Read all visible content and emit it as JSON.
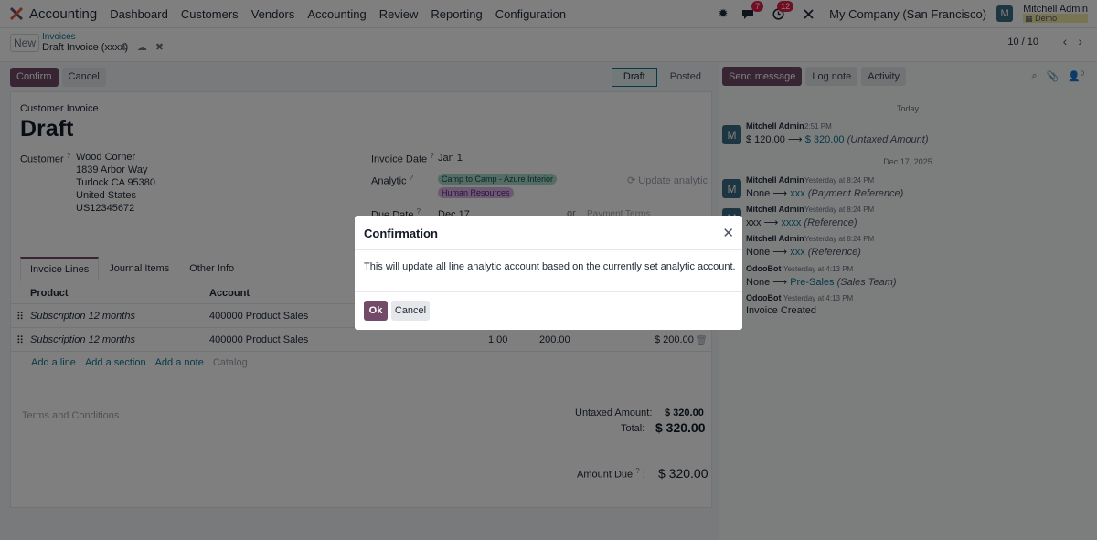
{
  "topbar": {
    "app_name": "Accounting",
    "menu": [
      "Dashboard",
      "Customers",
      "Vendors",
      "Accounting",
      "Review",
      "Reporting",
      "Configuration"
    ],
    "chat_badge": "7",
    "activity_badge": "12",
    "company": "My Company (San Francisco)",
    "user_initial": "M",
    "user_name": "Mitchell Admin",
    "user_db": "Demo"
  },
  "control": {
    "new_label": "New",
    "breadcrumb": "Invoices",
    "record_title": "Draft Invoice (xxxx)",
    "pager": "10 / 10"
  },
  "status": {
    "confirm_label": "Confirm",
    "cancel_label": "Cancel",
    "stages": [
      "Draft",
      "Posted"
    ]
  },
  "form": {
    "doc_type": "Customer Invoice",
    "state": "Draft",
    "customer_label": "Customer",
    "customer_lines": [
      "Wood Corner",
      "1839 Arbor Way",
      "Turlock CA 95380",
      "United States",
      "US12345672"
    ],
    "invoice_date_label": "Invoice Date",
    "invoice_date": "Jan 1",
    "analytic_label": "Analytic",
    "analytic_tags": [
      "Camp to Camp - Azure Interior",
      "Human Resources"
    ],
    "update_analytic": "Update analytic",
    "due_date_label": "Due Date",
    "due_date": "Dec 17",
    "or_label": "or",
    "payment_terms_placeholder": "Payment Terms",
    "help_mark": "?"
  },
  "tabs": [
    "Invoice Lines",
    "Journal Items",
    "Other Info"
  ],
  "lines": {
    "headers": [
      "Product",
      "Account"
    ],
    "rows": [
      {
        "product": "Subscription 12 months",
        "account": "400000 Product Sales",
        "qty": "",
        "price": "",
        "subtotal": ""
      },
      {
        "product": "Subscription 12 months",
        "account": "400000 Product Sales",
        "qty": "1.00",
        "price": "200.00",
        "subtotal": "$ 200.00"
      }
    ],
    "add_line": "Add a line",
    "add_section": "Add a section",
    "add_note": "Add a note",
    "catalog": "Catalog"
  },
  "totals": {
    "terms_placeholder": "Terms and Conditions",
    "untaxed_label": "Untaxed Amount:",
    "untaxed_value": "$ 320.00",
    "total_label": "Total:",
    "total_value": "$ 320.00",
    "amount_due_label": "Amount Due",
    "amount_due_colon": ":",
    "amount_due_value": "$ 320.00"
  },
  "chatter": {
    "send_message": "Send message",
    "log_note": "Log note",
    "activity": "Activity",
    "followers_count": "0",
    "date_today": "Today",
    "date_old": "Dec 17, 2025",
    "messages": [
      {
        "initial": "M",
        "author": "Mitchell Admin",
        "time": "2:51 PM",
        "old": "$ 120.00",
        "arrow": "⟶",
        "new": "$ 320.00",
        "field": "(Untaxed Amount)"
      },
      {
        "initial": "M",
        "author": "Mitchell Admin",
        "time": "Yesterday at 8:24 PM",
        "old": "None",
        "arrow": "⟶",
        "new": "xxx",
        "field": "(Payment Reference)"
      },
      {
        "initial": "M",
        "author": "Mitchell Admin",
        "time": "Yesterday at 8:24 PM",
        "old": "xxx",
        "arrow": "⟶",
        "new": "xxxx",
        "field": "(Reference)"
      },
      {
        "initial": "M",
        "author": "Mitchell Admin",
        "time": "Yesterday at 8:24 PM",
        "old": "None",
        "arrow": "⟶",
        "new": "xxx",
        "field": "(Reference)"
      },
      {
        "initial": "O",
        "author": "OdooBot",
        "time": "Yesterday at 4:13 PM",
        "old": "None",
        "arrow": "⟶",
        "new": "Pre-Sales",
        "field": "(Sales Team)"
      },
      {
        "initial": "O",
        "author": "OdooBot",
        "time": "Yesterday at 4:13 PM",
        "body": "Invoice Created"
      }
    ]
  },
  "modal": {
    "title": "Confirmation",
    "body": "This will update all line analytic account based on the currently set analytic account.",
    "ok_label": "Ok",
    "cancel_label": "Cancel"
  }
}
